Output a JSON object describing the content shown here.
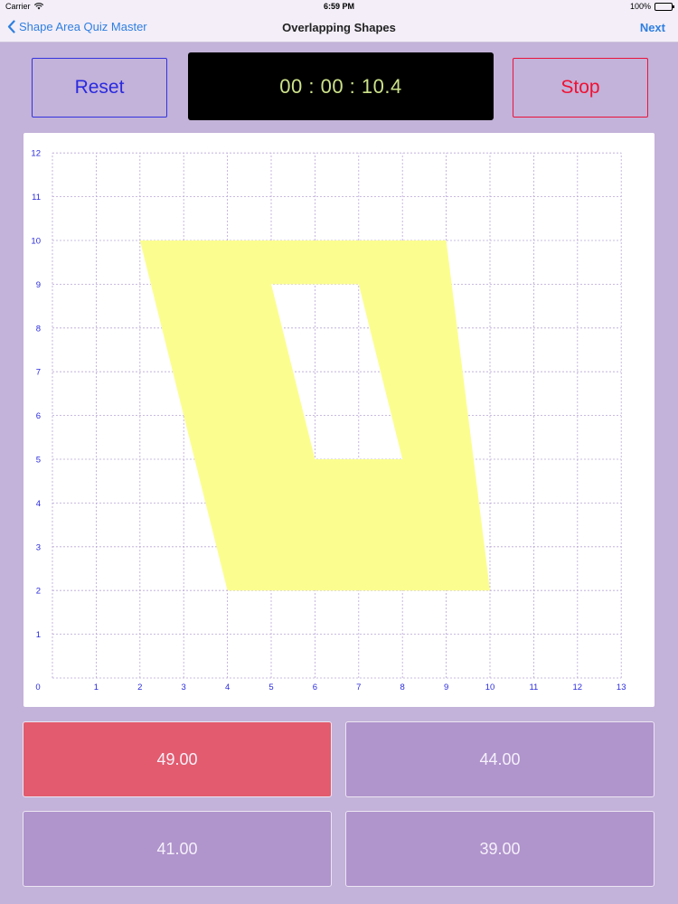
{
  "status_bar": {
    "carrier": "Carrier",
    "time": "6:59 PM",
    "battery": "100%"
  },
  "nav": {
    "back_label": "Shape Area Quiz Master",
    "title": "Overlapping Shapes",
    "next_label": "Next"
  },
  "controls": {
    "reset_label": "Reset",
    "timer": "00 : 00 : 10.4",
    "stop_label": "Stop"
  },
  "graph": {
    "x_ticks": [
      "0",
      "1",
      "2",
      "3",
      "4",
      "5",
      "6",
      "7",
      "8",
      "9",
      "10",
      "11",
      "12",
      "13"
    ],
    "y_ticks": [
      "1",
      "2",
      "3",
      "4",
      "5",
      "6",
      "7",
      "8",
      "9",
      "10",
      "11",
      "12"
    ],
    "x_max": 13,
    "y_max": 12,
    "grid": true,
    "outer_shape": [
      [
        2,
        10
      ],
      [
        9,
        10
      ],
      [
        10,
        2
      ],
      [
        4,
        2
      ]
    ],
    "hole_shape": [
      [
        5,
        9
      ],
      [
        7,
        9
      ],
      [
        8,
        5
      ],
      [
        6,
        5
      ]
    ],
    "fill_color": "#fbfe8f",
    "tick_color": "#2a2adf",
    "grid_color": "#b9a6d6"
  },
  "answers": [
    {
      "label": "49.00",
      "color": "#e35b6e"
    },
    {
      "label": "44.00",
      "color": "#b094cc"
    },
    {
      "label": "41.00",
      "color": "#b094cc"
    },
    {
      "label": "39.00",
      "color": "#b094cc"
    }
  ],
  "colors": {
    "background": "#c3b2d9",
    "link": "#2f7fe0"
  }
}
